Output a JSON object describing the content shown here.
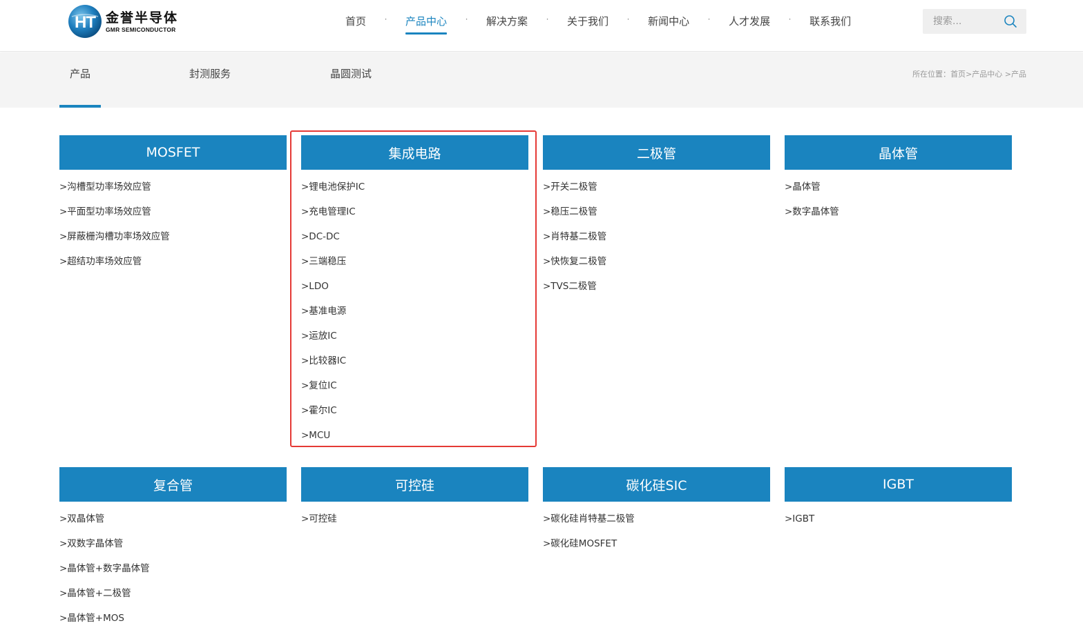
{
  "brand": {
    "logo_mark": "HT",
    "name_cn": "金誉半导体",
    "name_en": "GMR SEMICONDUCTOR",
    "color": "#1a84bf"
  },
  "nav": {
    "items": [
      "首页",
      "产品中心",
      "解决方案",
      "关于我们",
      "新闻中心",
      "人才发展",
      "联系我们"
    ],
    "active_index": 1,
    "separator": "·"
  },
  "search": {
    "placeholder": "搜索...",
    "icon": "search-icon"
  },
  "subnav": {
    "tabs": [
      "产品",
      "封测服务",
      "晶圆测试"
    ],
    "active_index": 0
  },
  "breadcrumb": {
    "prefix": "所在位置：",
    "items": [
      "首页",
      "产品中心",
      "产品"
    ],
    "separator": ">"
  },
  "categories": [
    {
      "title": "MOSFET",
      "items": [
        ">沟槽型功率场效应管",
        ">平面型功率场效应管",
        ">屏蔽栅沟槽功率场效应管",
        ">超结功率场效应管"
      ]
    },
    {
      "title": "集成电路",
      "items": [
        ">锂电池保护IC",
        ">充电管理IC",
        ">DC-DC",
        ">三端稳压",
        ">LDO",
        ">基准电源",
        ">运放IC",
        ">比较器IC",
        ">复位IC",
        ">霍尔IC",
        ">MCU"
      ]
    },
    {
      "title": "二极管",
      "items": [
        ">开关二极管",
        ">稳压二极管",
        ">肖特基二极管",
        ">快恢复二极管",
        ">TVS二极管"
      ]
    },
    {
      "title": "晶体管",
      "items": [
        ">晶体管",
        ">数字晶体管"
      ]
    },
    {
      "title": "复合管",
      "items": [
        ">双晶体管",
        ">双数字晶体管",
        ">晶体管+数字晶体管",
        ">晶体管+二极管",
        ">晶体管+MOS"
      ]
    },
    {
      "title": "可控硅",
      "items": [
        ">可控硅"
      ]
    },
    {
      "title": "碳化硅SIC",
      "items": [
        ">碳化硅肖特基二极管",
        ">碳化硅MOSFET"
      ]
    },
    {
      "title": "IGBT",
      "items": [
        ">IGBT"
      ]
    }
  ],
  "highlight_color": "#e53935"
}
